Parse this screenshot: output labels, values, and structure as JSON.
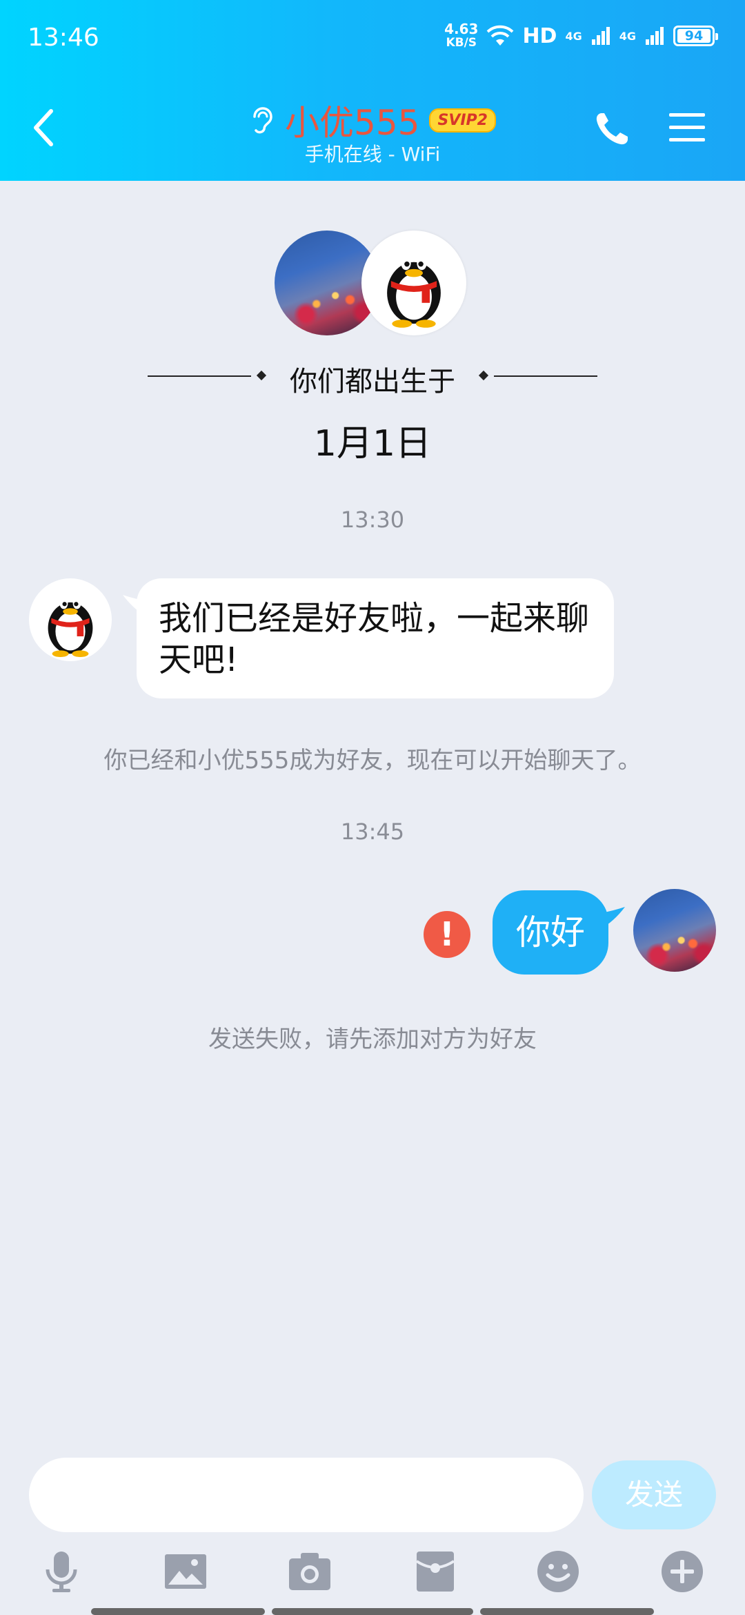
{
  "status_bar": {
    "time": "13:46",
    "net_speed_value": "4.63",
    "net_speed_unit": "KB/S",
    "hd_label": "HD",
    "sim1_label": "4G",
    "sim2_label": "4G",
    "battery": "94"
  },
  "header": {
    "contact_name": "小优555",
    "vip_badge": "SVIP2",
    "online_status": "手机在线 - WiFi",
    "accent_color": "#12b7fb",
    "name_color": "#e9563f"
  },
  "birthday_banner": {
    "text": "你们都出生于",
    "date": "1月1日"
  },
  "messages": [
    {
      "type": "time",
      "text": "13:30"
    },
    {
      "type": "incoming",
      "text": "我们已经是好友啦，一起来聊天吧!"
    },
    {
      "type": "system",
      "text": "你已经和小优555成为好友，现在可以开始聊天了。"
    },
    {
      "type": "time",
      "text": "13:45"
    },
    {
      "type": "outgoing",
      "text": "你好",
      "status": "failed"
    },
    {
      "type": "system",
      "text": "发送失败，请先添加对方为好友"
    }
  ],
  "input_bar": {
    "placeholder": "",
    "send_label": "发送"
  },
  "toolbar": {
    "icons": [
      "microphone-icon",
      "image-icon",
      "camera-icon",
      "red-packet-icon",
      "emoji-icon",
      "plus-icon"
    ]
  }
}
